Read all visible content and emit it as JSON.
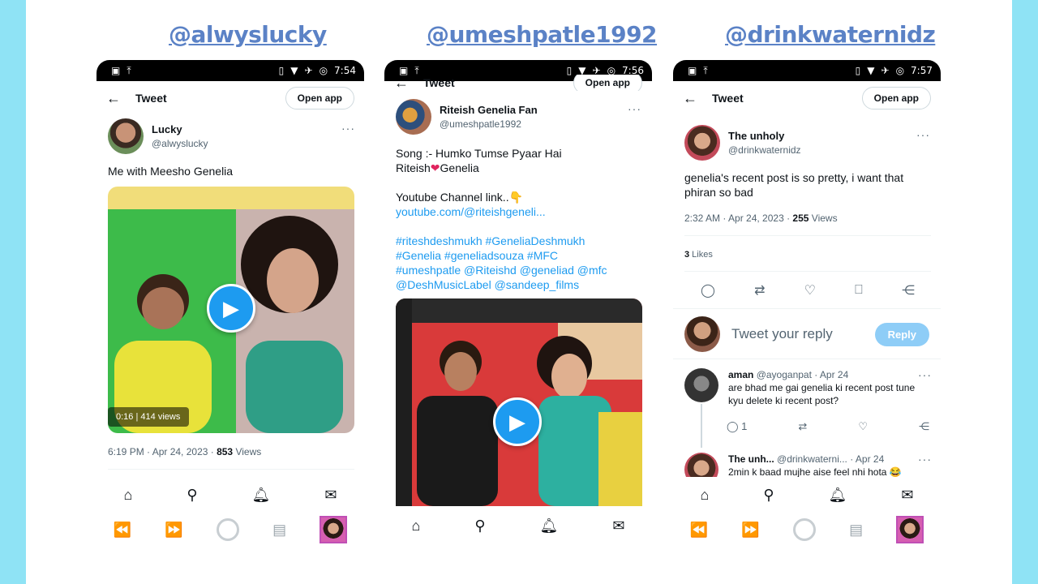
{
  "handles": [
    "@alwyslucky",
    "@umeshpatle1992",
    "@drinkwaternidz"
  ],
  "common": {
    "tweet_title": "Tweet",
    "open_app": "Open app",
    "more": "···"
  },
  "phone1": {
    "status_time": "7:54",
    "author_name": "Lucky",
    "author_handle": "@alwyslucky",
    "text": "Me with Meesho Genelia",
    "video_duration": "0:16",
    "video_views": "414 views",
    "timestamp": "6:19 PM · Apr 24, 2023 · ",
    "views_count": "853",
    "views_label": " Views"
  },
  "phone2": {
    "status_time": "7:56",
    "author_name": "Riteish Genelia Fan",
    "author_handle": "@umeshpatle1992",
    "line1": "Song :- Humko Tumse Pyaar Hai",
    "line2a": "Riteish",
    "line2b": "Genelia",
    "line3": "Youtube Channel link..",
    "link": "youtube.com/@riteishgeneli...",
    "hashtags1": "#riteshdeshmukh #GeneliaDeshmukh",
    "hashtags2": "#Genelia #geneliadsouza #MFC",
    "hashtags3": "#umeshpatle @Riteishd @geneliad @mfc",
    "hashtags4": "@DeshMusicLabel @sandeep_films"
  },
  "phone3": {
    "status_time": "7:57",
    "author_name": "The unholy",
    "author_handle": "@drinkwaternidz",
    "text": "genelia's recent post is so pretty, i want that phiran so bad",
    "timestamp": "2:32 AM · Apr 24, 2023 · ",
    "views_count": "255",
    "views_label": " Views",
    "likes_count": "3",
    "likes_label": " Likes",
    "reply_placeholder": "Tweet your reply",
    "reply_button": "Reply",
    "reply1_name": "aman",
    "reply1_meta": " @ayoganpat · Apr 24",
    "reply1_text": "are bhad me gai genelia ki recent post tune kyu delete ki recent post?",
    "reply1_count": "1",
    "reply2_name": "The unh...",
    "reply2_meta": " @drinkwaterni... · Apr 24",
    "reply2_text": "2min k baad mujhe aise feel nhi hota 😂"
  }
}
